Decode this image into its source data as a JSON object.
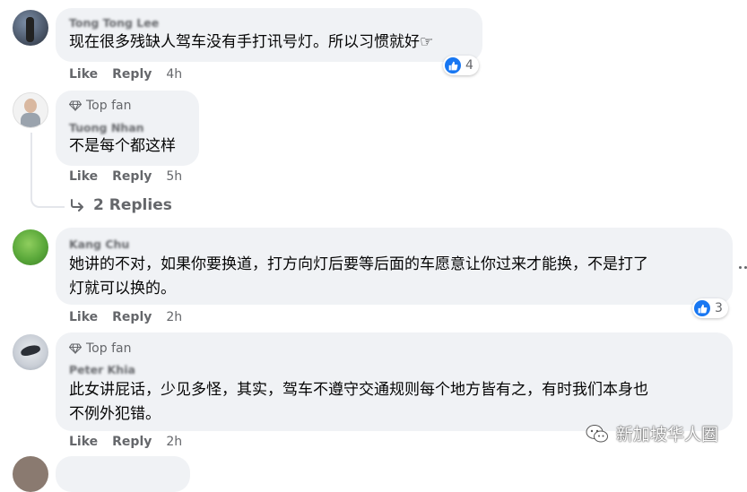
{
  "comments": [
    {
      "name": "Tong Tong Lee",
      "badge": "",
      "text": [
        "现在很多残缺人驾车没有手打讯号灯。所以习惯就好☞"
      ],
      "like": "Like",
      "reply": "Reply",
      "time": "4h",
      "reaction_count": "4"
    },
    {
      "name": "Tuong Nhan",
      "badge": "Top fan",
      "text": [
        "不是每个都这样"
      ],
      "like": "Like",
      "reply": "Reply",
      "time": "5h",
      "reaction_count": "",
      "replies_label": "2 Replies"
    },
    {
      "name": "Kang Chu",
      "badge": "",
      "text": [
        "她讲的不对，如果你要换道，打方向灯后要等后面的车愿意让你过来才能换，不是打了",
        "灯就可以换的。"
      ],
      "like": "Like",
      "reply": "Reply",
      "time": "2h",
      "reaction_count": "3"
    },
    {
      "name": "Peter Khia",
      "badge": "Top fan",
      "text": [
        "此女讲屁话，少见多怪，其实，驾车不遵守交通规则每个地方皆有之，有时我们本身也",
        "不例外犯错。"
      ],
      "like": "Like",
      "reply": "Reply",
      "time": "2h",
      "reaction_count": ""
    }
  ],
  "watermark": {
    "text": "新加坡华人圈"
  },
  "colors": {
    "like_blue": "#1877f2",
    "bubble": "#f0f2f5",
    "secondary_text": "#65676b"
  }
}
